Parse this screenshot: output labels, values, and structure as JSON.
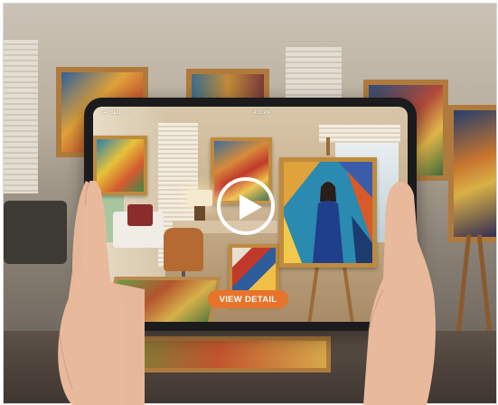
{
  "status_bar": {
    "carrier": "BELL",
    "time": "4:21 PM"
  },
  "video": {
    "play_icon": "play-icon"
  },
  "cta": {
    "label": "VIEW DETAIL"
  },
  "colors": {
    "accent": "#e8732a",
    "tablet_bezel": "#1b1b1d",
    "frame_gold": "#c08a3e"
  }
}
